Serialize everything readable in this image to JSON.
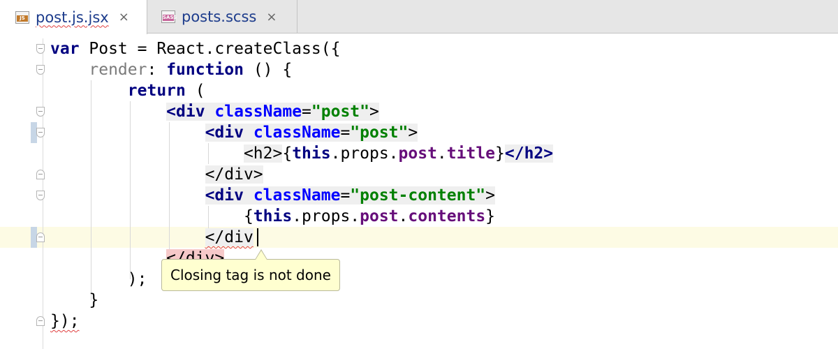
{
  "tabs": [
    {
      "label": "post.js.jsx",
      "icon": "js-file-icon",
      "badge": "JS",
      "active": true
    },
    {
      "label": "posts.scss",
      "icon": "sass-file-icon",
      "badge": "SASS",
      "active": false
    }
  ],
  "close_glyph": "×",
  "code": {
    "l1": {
      "a": "var",
      "b": " Post = React.createClass({"
    },
    "l2": {
      "a": "render",
      "b": ": ",
      "c": "function",
      "d": " () {"
    },
    "l3": {
      "a": "return",
      "b": " ("
    },
    "l4": {
      "a": "<div",
      "b": " ",
      "c": "className",
      "d": "=",
      "e": "\"post\"",
      "f": ">"
    },
    "l5": {
      "a": "<div",
      "b": " ",
      "c": "className",
      "d": "=",
      "e": "\"post\"",
      "f": ">"
    },
    "l6": {
      "a": "<h2>",
      "b": "{",
      "c": "this",
      "d": ".props.",
      "e": "post",
      "f": ".",
      "g": "title",
      "h": "}",
      "i": "</h2>"
    },
    "l7": {
      "a": "</div>"
    },
    "l8": {
      "a": "<div",
      "b": " ",
      "c": "className",
      "d": "=",
      "e": "\"post-content\"",
      "f": ">"
    },
    "l9": {
      "a": "{",
      "b": "this",
      "c": ".props.",
      "d": "post",
      "e": ".",
      "f": "contents",
      "g": "}"
    },
    "l10": {
      "a": "</div"
    },
    "l11": {
      "a": "</div>"
    },
    "l12": {
      "a": ");"
    },
    "l13": {
      "a": "}"
    },
    "l14": {
      "a": "});"
    }
  },
  "tooltip": {
    "text": "Closing tag is not done"
  },
  "colors": {
    "keyword": "#000080",
    "member": "#660e7a",
    "attribute": "#0000ff",
    "string": "#008000",
    "caret_row": "#fdfbe4",
    "error_highlight": "#f6c9c9",
    "tooltip_bg": "#ffffd0"
  }
}
